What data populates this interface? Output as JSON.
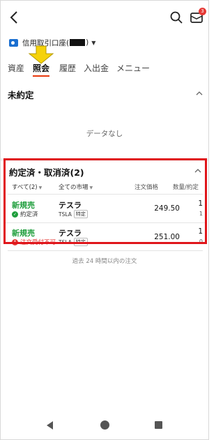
{
  "header": {
    "badge_count": "3",
    "icons": [
      "back-arrow-icon",
      "search-icon",
      "mail-icon"
    ]
  },
  "account": {
    "label_prefix": "信用取引口座(",
    "label_suffix": ")"
  },
  "tabs": [
    {
      "label": "資産",
      "active": false
    },
    {
      "label": "照会",
      "active": true
    },
    {
      "label": "履歴",
      "active": false
    },
    {
      "label": "入出金",
      "active": false
    },
    {
      "label": "メニュー",
      "active": false
    }
  ],
  "unexecuted": {
    "title": "未約定",
    "empty_text": "データなし"
  },
  "executed": {
    "title": "約定済・取消済(2)",
    "filters": {
      "all": "すべて(2)",
      "market": "全ての市場"
    },
    "columns": {
      "price": "注文価格",
      "qty": "数量/約定"
    },
    "orders": [
      {
        "type": "新規売",
        "status": "約定済",
        "status_color": "#1e9e3c",
        "name": "テスラ",
        "ticker": "TSLA",
        "account_tag": "特定",
        "price": "249.50",
        "qty": "1",
        "filled": "1"
      },
      {
        "type": "新規売",
        "status": "注文受付不可",
        "status_color": "#e53935",
        "name": "テスラ",
        "ticker": "TSLA",
        "account_tag": "特定",
        "price": "251.00",
        "qty": "1",
        "filled": "0"
      }
    ],
    "footnote": "過去 24 時間以内の注文"
  },
  "colors": {
    "accent_tab_underline": "#e8380d",
    "highlight_box": "#e0161b",
    "buy_sell_green": "#1e9e3c",
    "arrow_yellow": "#f5d20a"
  }
}
